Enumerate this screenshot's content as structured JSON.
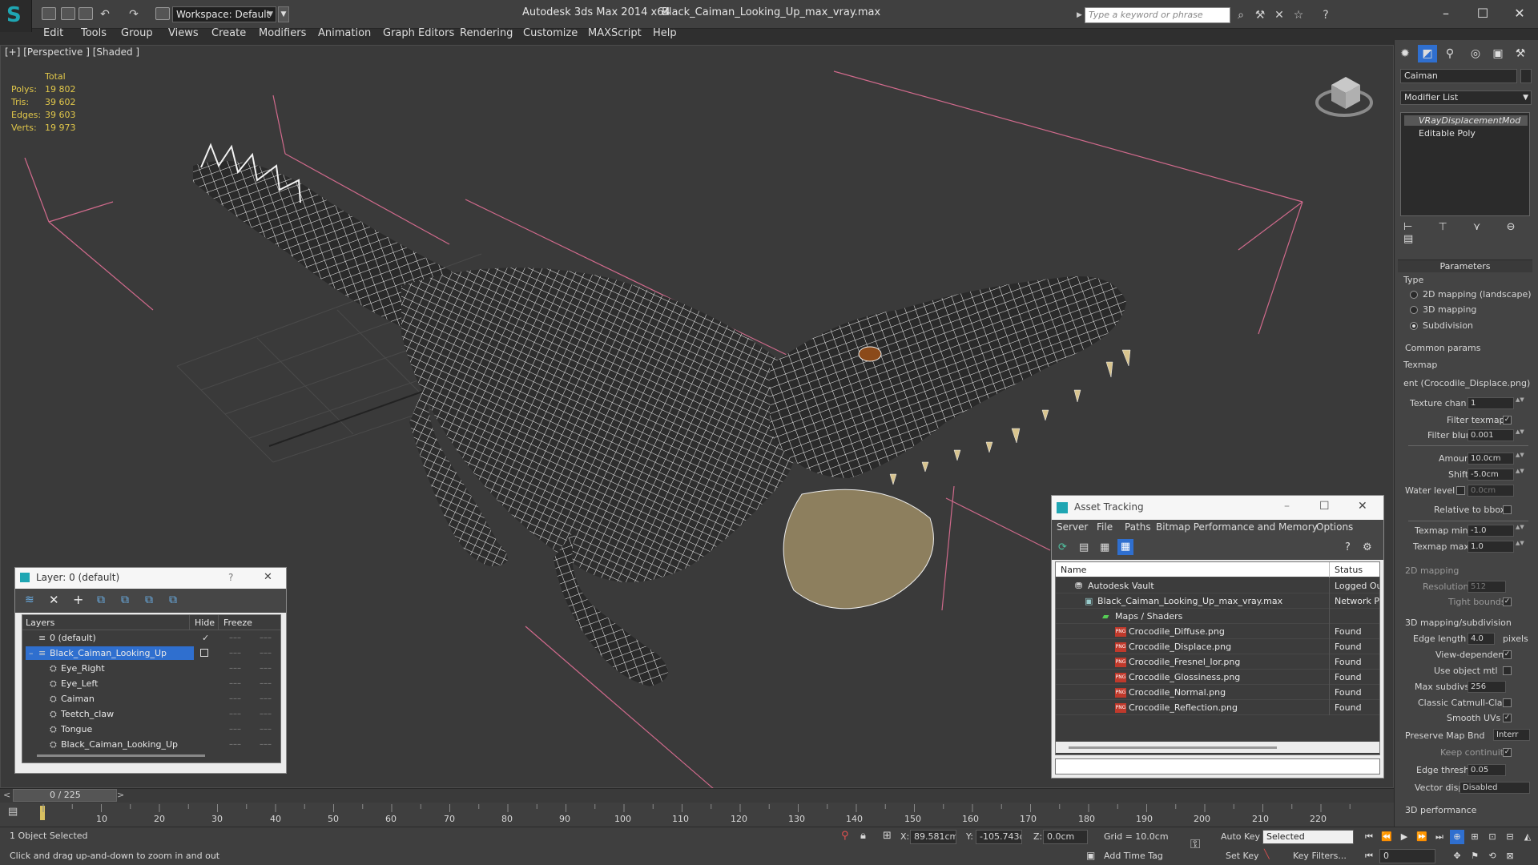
{
  "title_bar": {
    "app_name": "Autodesk 3ds Max  2014 x64",
    "file_name": "Black_Caiman_Looking_Up_max_vray.max",
    "workspace": "Workspace: Default",
    "search_placeholder": "Type a keyword or phrase"
  },
  "menu": [
    "Edit",
    "Tools",
    "Group",
    "Views",
    "Create",
    "Modifiers",
    "Animation",
    "Graph Editors",
    "Rendering",
    "Customize",
    "MAXScript",
    "Help"
  ],
  "viewport": {
    "label": "[+] [Perspective ] [Shaded ]",
    "stats_header": "Total",
    "stats": [
      {
        "label": "Polys:",
        "value": "19 802"
      },
      {
        "label": "Tris:",
        "value": "39 602"
      },
      {
        "label": "Edges:",
        "value": "39 603"
      },
      {
        "label": "Verts:",
        "value": "19 973"
      }
    ]
  },
  "command_panel": {
    "object_name": "Caiman",
    "modifier_list": "Modifier List",
    "stack": [
      "VRayDisplacementMod",
      "Editable Poly"
    ],
    "parameters_header": "Parameters",
    "type_label": "Type",
    "type_options": [
      {
        "label": "2D mapping (landscape)",
        "selected": false
      },
      {
        "label": "3D mapping",
        "selected": false
      },
      {
        "label": "Subdivision",
        "selected": true
      }
    ],
    "common_params": "Common params",
    "texmap_label": "Texmap",
    "texmap_value": "ent (Crocodile_Displace.png)",
    "texture_chan_label": "Texture chan",
    "texture_chan": "1",
    "filter_texmap": "Filter texmap",
    "filter_blur_label": "Filter blur",
    "filter_blur": "0.001",
    "amount_label": "Amount",
    "amount": "10.0cm",
    "shift_label": "Shift",
    "shift": "-5.0cm",
    "water_level_label": "Water level",
    "water_level": "0.0cm",
    "relative_bbox": "Relative to bbox",
    "texmap_min_label": "Texmap min",
    "texmap_min": "-1.0",
    "texmap_max_label": "Texmap max",
    "texmap_max": "1.0",
    "mapping_2d": "2D mapping",
    "resolution_label": "Resolution",
    "resolution": "512",
    "tight_bounds": "Tight bounds",
    "mapping_3d": "3D mapping/subdivision",
    "edge_length_label": "Edge length",
    "edge_length": "4.0",
    "pixels": "pixels",
    "view_dependent": "View-dependent",
    "use_object_mtl": "Use object mtl",
    "max_subdivs_label": "Max subdivs",
    "max_subdivs": "256",
    "classic_catmull": "Classic Catmull-Clark",
    "smooth_uvs": "Smooth UVs",
    "preserve_map_label": "Preserve Map Bnd",
    "preserve_map": "Interr",
    "keep_continuity": "Keep continuity",
    "edge_thresh_label": "Edge thresh",
    "edge_thresh": "0.05",
    "vector_displ_label": "Vector displ",
    "vector_displ": "Disabled",
    "performance_3d": "3D performance"
  },
  "layer_dialog": {
    "title": "Layer: 0 (default)",
    "help": "?",
    "close": "✕",
    "col_layers": "Layers",
    "col_hide": "Hide",
    "col_freeze": "Freeze",
    "rows": [
      {
        "name": "0 (default)",
        "indent": 0,
        "selected": false,
        "active": true
      },
      {
        "name": "Black_Caiman_Looking_Up",
        "indent": 0,
        "selected": true,
        "active": false
      },
      {
        "name": "Eye_Right",
        "indent": 1,
        "selected": false,
        "active": false
      },
      {
        "name": "Eye_Left",
        "indent": 1,
        "selected": false,
        "active": false
      },
      {
        "name": "Caiman",
        "indent": 1,
        "selected": false,
        "active": false
      },
      {
        "name": "Teetch_claw",
        "indent": 1,
        "selected": false,
        "active": false
      },
      {
        "name": "Tongue",
        "indent": 1,
        "selected": false,
        "active": false
      },
      {
        "name": "Black_Caiman_Looking_Up",
        "indent": 1,
        "selected": false,
        "active": false
      }
    ]
  },
  "asset_dialog": {
    "title": "Asset Tracking",
    "menu": [
      "Server",
      "File",
      "Paths",
      "Bitmap Performance and Memory",
      "Options"
    ],
    "col_name": "Name",
    "col_status": "Status",
    "rows": [
      {
        "name": "Autodesk Vault",
        "status": "Logged Out",
        "indent": 0,
        "kind": "vault"
      },
      {
        "name": "Black_Caiman_Looking_Up_max_vray.max",
        "status": "Network Pa",
        "indent": 1,
        "kind": "max"
      },
      {
        "name": "Maps / Shaders",
        "status": "",
        "indent": 2,
        "kind": "folder"
      },
      {
        "name": "Crocodile_Diffuse.png",
        "status": "Found",
        "indent": 3,
        "kind": "png"
      },
      {
        "name": "Crocodile_Displace.png",
        "status": "Found",
        "indent": 3,
        "kind": "png"
      },
      {
        "name": "Crocodile_Fresnel_Ior.png",
        "status": "Found",
        "indent": 3,
        "kind": "png"
      },
      {
        "name": "Crocodile_Glossiness.png",
        "status": "Found",
        "indent": 3,
        "kind": "png"
      },
      {
        "name": "Crocodile_Normal.png",
        "status": "Found",
        "indent": 3,
        "kind": "png"
      },
      {
        "name": "Crocodile_Reflection.png",
        "status": "Found",
        "indent": 3,
        "kind": "png"
      }
    ]
  },
  "timeline": {
    "frame": "0 / 225",
    "ticks": [
      "10",
      "20",
      "30",
      "40",
      "50",
      "60",
      "70",
      "80",
      "90",
      "100",
      "110",
      "120",
      "130",
      "140",
      "150",
      "160",
      "170",
      "180",
      "190",
      "200",
      "210",
      "220"
    ]
  },
  "status_bar": {
    "selection": "1 Object Selected",
    "prompt": "Click and drag up-and-down to zoom in and out",
    "x_label": "X:",
    "x_value": "89.581cm",
    "y_label": "Y:",
    "y_value": "-105.743c",
    "z_label": "Z:",
    "z_value": "0.0cm",
    "grid": "Grid = 10.0cm",
    "add_time_tag": "Add Time Tag",
    "auto_key": "Auto Key",
    "set_key": "Set Key",
    "key_mode": "Selected",
    "key_filters": "Key Filters...",
    "current_frame": "0"
  },
  "colors": {
    "accent_teal": "#1fa6b3",
    "selection_blue": "#2f6fcf",
    "stats_yellow": "#e2c84a",
    "wire": "#ffffff",
    "pink_lines": "#d06a8c"
  }
}
